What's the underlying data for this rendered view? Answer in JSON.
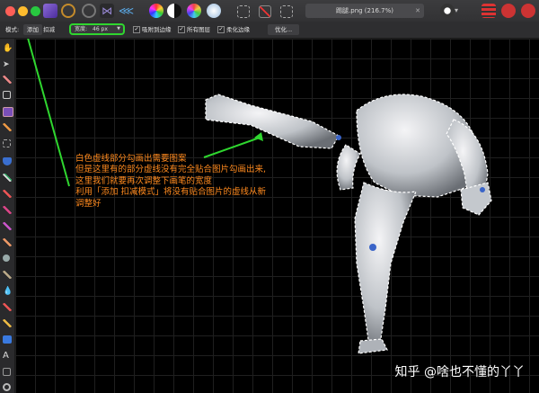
{
  "titlebar": {
    "document_tab": "踢腿.png (216.7%)",
    "close_symbol": "✕"
  },
  "context_toolbar": {
    "mode_label": "模式:",
    "add_button": "添加",
    "subtract_button": "扣减",
    "width_label": "宽度:",
    "width_value": "46 px",
    "snap_edges": "吸附到边缘",
    "all_layers": "所有图层",
    "soft_edges": "柔化边缘",
    "refine_button": "优化...",
    "highlight_color": "#2fd62f"
  },
  "annotation": {
    "line1": "白色虚线部分勾画出需要图案",
    "line2": "但是这里有的部分虚线没有完全贴合图片勾画出来,",
    "line3": "这里我们就要再次调整下画笔的宽度",
    "line4": "利用「添加  扣减模式」将没有贴合图片的虚线从新",
    "line5": "调整好",
    "color": "#ff8a1e"
  },
  "watermark": "知乎 @啥也不懂的丫丫",
  "icons": {
    "toolbar": [
      "hand-icon",
      "move-icon",
      "color-picker-icon",
      "crop-icon",
      "selection-brush-icon",
      "flood-select-icon",
      "marquee-icon",
      "fill-icon",
      "paint-brush-icon",
      "pixel-brush-icon",
      "erase-brush-icon",
      "dodge-icon",
      "clone-icon",
      "healing-icon",
      "blur-icon",
      "sharpen-icon",
      "pen-icon",
      "node-icon",
      "shape-icon",
      "text-icon",
      "mesh-icon",
      "zoom-icon"
    ]
  }
}
